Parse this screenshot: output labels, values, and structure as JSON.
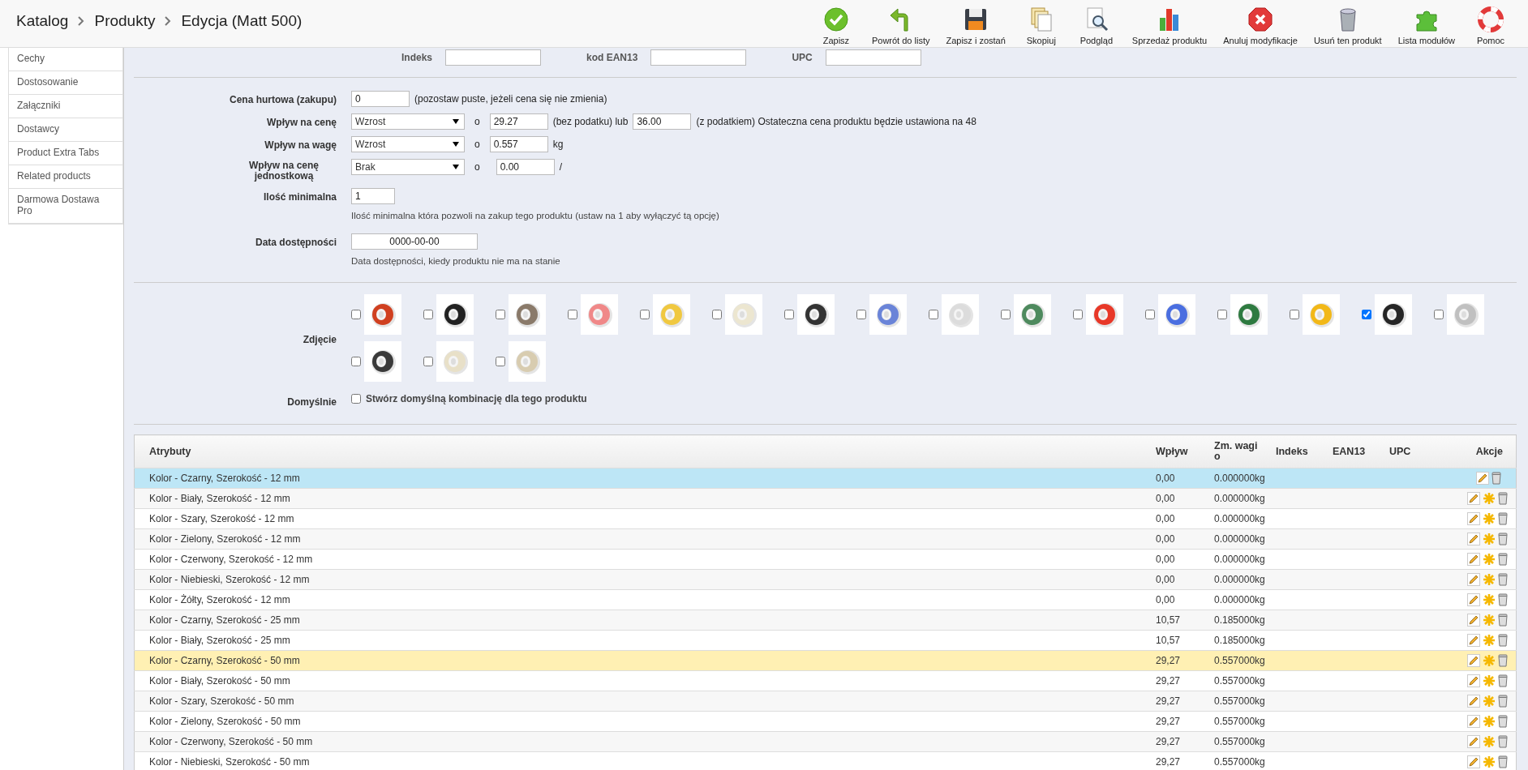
{
  "breadcrumb": [
    "Katalog",
    "Produkty",
    "Edycja (Matt 500)"
  ],
  "toolbar": [
    {
      "label": "Zapisz",
      "kind": "save"
    },
    {
      "label": "Powrót do listy",
      "kind": "back"
    },
    {
      "label": "Zapisz i zostań",
      "kind": "disk"
    },
    {
      "label": "Skopiuj",
      "kind": "copy"
    },
    {
      "label": "Podgląd",
      "kind": "preview"
    },
    {
      "label": "Sprzedaż produktu",
      "kind": "chart"
    },
    {
      "label": "Anuluj modyfikacje",
      "kind": "cancel"
    },
    {
      "label": "Usuń ten produkt",
      "kind": "trash"
    },
    {
      "label": "Lista modułów",
      "kind": "puzzle"
    },
    {
      "label": "Pomoc",
      "kind": "help"
    }
  ],
  "sidebar": {
    "items": [
      "Cechy",
      "Dostosowanie",
      "Załączniki",
      "Dostawcy",
      "Product Extra Tabs",
      "Related products",
      "Darmowa Dostawa Pro"
    ]
  },
  "codes": [
    {
      "label": "Indeks"
    },
    {
      "label": "kod EAN13"
    },
    {
      "label": "UPC"
    }
  ],
  "wholesale": {
    "label": "Cena hurtowa (zakupu)",
    "value": "0",
    "note": "(pozostaw puste, jeżeli cena się nie zmienia)"
  },
  "price_impact": {
    "label": "Wpływ na cenę",
    "select": "Wzrost",
    "o": "o",
    "value": "29.27",
    "between": "(bez podatku) lub",
    "value_tax": "36.00",
    "note": "(z podatkiem) Ostateczna cena produktu będzie ustawiona na 48"
  },
  "weight_impact": {
    "label": "Wpływ na wagę",
    "select": "Wzrost",
    "o": "o",
    "value": "0.557",
    "unit": "kg"
  },
  "unit_impact": {
    "label": "Wpływ na cenę jednostkową",
    "select": "Brak",
    "o": "o",
    "value": "0.00",
    "unit": "/"
  },
  "min_qty": {
    "label": "Ilość minimalna",
    "value": "1",
    "hint": "Ilość minimalna która pozwoli na zakup tego produktu (ustaw na 1 aby wyłączyć tą opcję)"
  },
  "availability": {
    "label": "Data dostępności",
    "value": "0000-00-00",
    "hint": "Data dostępności, kiedy produktu nie ma na stanie"
  },
  "images": {
    "label": "Zdjęcie",
    "items": [
      {
        "checked": false,
        "color": "#d04020"
      },
      {
        "checked": false,
        "color": "#222222"
      },
      {
        "checked": false,
        "color": "#8a7a6a"
      },
      {
        "checked": false,
        "color": "#f08888"
      },
      {
        "checked": false,
        "color": "#f0c840"
      },
      {
        "checked": false,
        "color": "#ece6d0"
      },
      {
        "checked": false,
        "color": "#333333"
      },
      {
        "checked": false,
        "color": "#6a84d8"
      },
      {
        "checked": false,
        "color": "#dcdcdc"
      },
      {
        "checked": false,
        "color": "#4e8a5e"
      },
      {
        "checked": false,
        "color": "#e83828"
      },
      {
        "checked": false,
        "color": "#4a6ee0"
      },
      {
        "checked": false,
        "color": "#2e7a40"
      },
      {
        "checked": false,
        "color": "#f2b818"
      },
      {
        "checked": true,
        "color": "#262626"
      },
      {
        "checked": false,
        "color": "#c0c0c0"
      },
      {
        "checked": false,
        "color": "#3a3a3a"
      },
      {
        "checked": false,
        "color": "#e8e0c8"
      },
      {
        "checked": false,
        "color": "#d8ccb0"
      }
    ]
  },
  "default_combination": {
    "label": "Domyślnie",
    "checked": false,
    "text": "Stwórz domyślną kombinację dla tego produktu"
  },
  "table": {
    "columns": [
      "Atrybuty",
      "Wpływ",
      "Zm. wagi o",
      "Indeks",
      "EAN13",
      "UPC",
      "Akcje"
    ],
    "rows": [
      {
        "name": "Kolor - Czarny, Szerokość - 12 mm",
        "impact": "0,00",
        "weight": "0.000000kg",
        "is_default": true,
        "selected": false
      },
      {
        "name": "Kolor - Biały, Szerokość - 12 mm",
        "impact": "0,00",
        "weight": "0.000000kg",
        "is_default": false,
        "selected": false
      },
      {
        "name": "Kolor - Szary, Szerokość - 12 mm",
        "impact": "0,00",
        "weight": "0.000000kg",
        "is_default": false,
        "selected": false
      },
      {
        "name": "Kolor - Zielony, Szerokość - 12 mm",
        "impact": "0,00",
        "weight": "0.000000kg",
        "is_default": false,
        "selected": false
      },
      {
        "name": "Kolor - Czerwony, Szerokość - 12 mm",
        "impact": "0,00",
        "weight": "0.000000kg",
        "is_default": false,
        "selected": false
      },
      {
        "name": "Kolor - Niebieski, Szerokość - 12 mm",
        "impact": "0,00",
        "weight": "0.000000kg",
        "is_default": false,
        "selected": false
      },
      {
        "name": "Kolor - Żółty, Szerokość - 12 mm",
        "impact": "0,00",
        "weight": "0.000000kg",
        "is_default": false,
        "selected": false
      },
      {
        "name": "Kolor - Czarny, Szerokość - 25 mm",
        "impact": "10,57",
        "weight": "0.185000kg",
        "is_default": false,
        "selected": false
      },
      {
        "name": "Kolor - Biały, Szerokość - 25 mm",
        "impact": "10,57",
        "weight": "0.185000kg",
        "is_default": false,
        "selected": false
      },
      {
        "name": "Kolor - Czarny, Szerokość - 50 mm",
        "impact": "29,27",
        "weight": "0.557000kg",
        "is_default": false,
        "selected": true
      },
      {
        "name": "Kolor - Biały, Szerokość - 50 mm",
        "impact": "29,27",
        "weight": "0.557000kg",
        "is_default": false,
        "selected": false
      },
      {
        "name": "Kolor - Szary, Szerokość - 50 mm",
        "impact": "29,27",
        "weight": "0.557000kg",
        "is_default": false,
        "selected": false
      },
      {
        "name": "Kolor - Zielony, Szerokość - 50 mm",
        "impact": "29,27",
        "weight": "0.557000kg",
        "is_default": false,
        "selected": false
      },
      {
        "name": "Kolor - Czerwony, Szerokość - 50 mm",
        "impact": "29,27",
        "weight": "0.557000kg",
        "is_default": false,
        "selected": false
      },
      {
        "name": "Kolor - Niebieski, Szerokość - 50 mm",
        "impact": "29,27",
        "weight": "0.557000kg",
        "is_default": false,
        "selected": false
      }
    ]
  }
}
